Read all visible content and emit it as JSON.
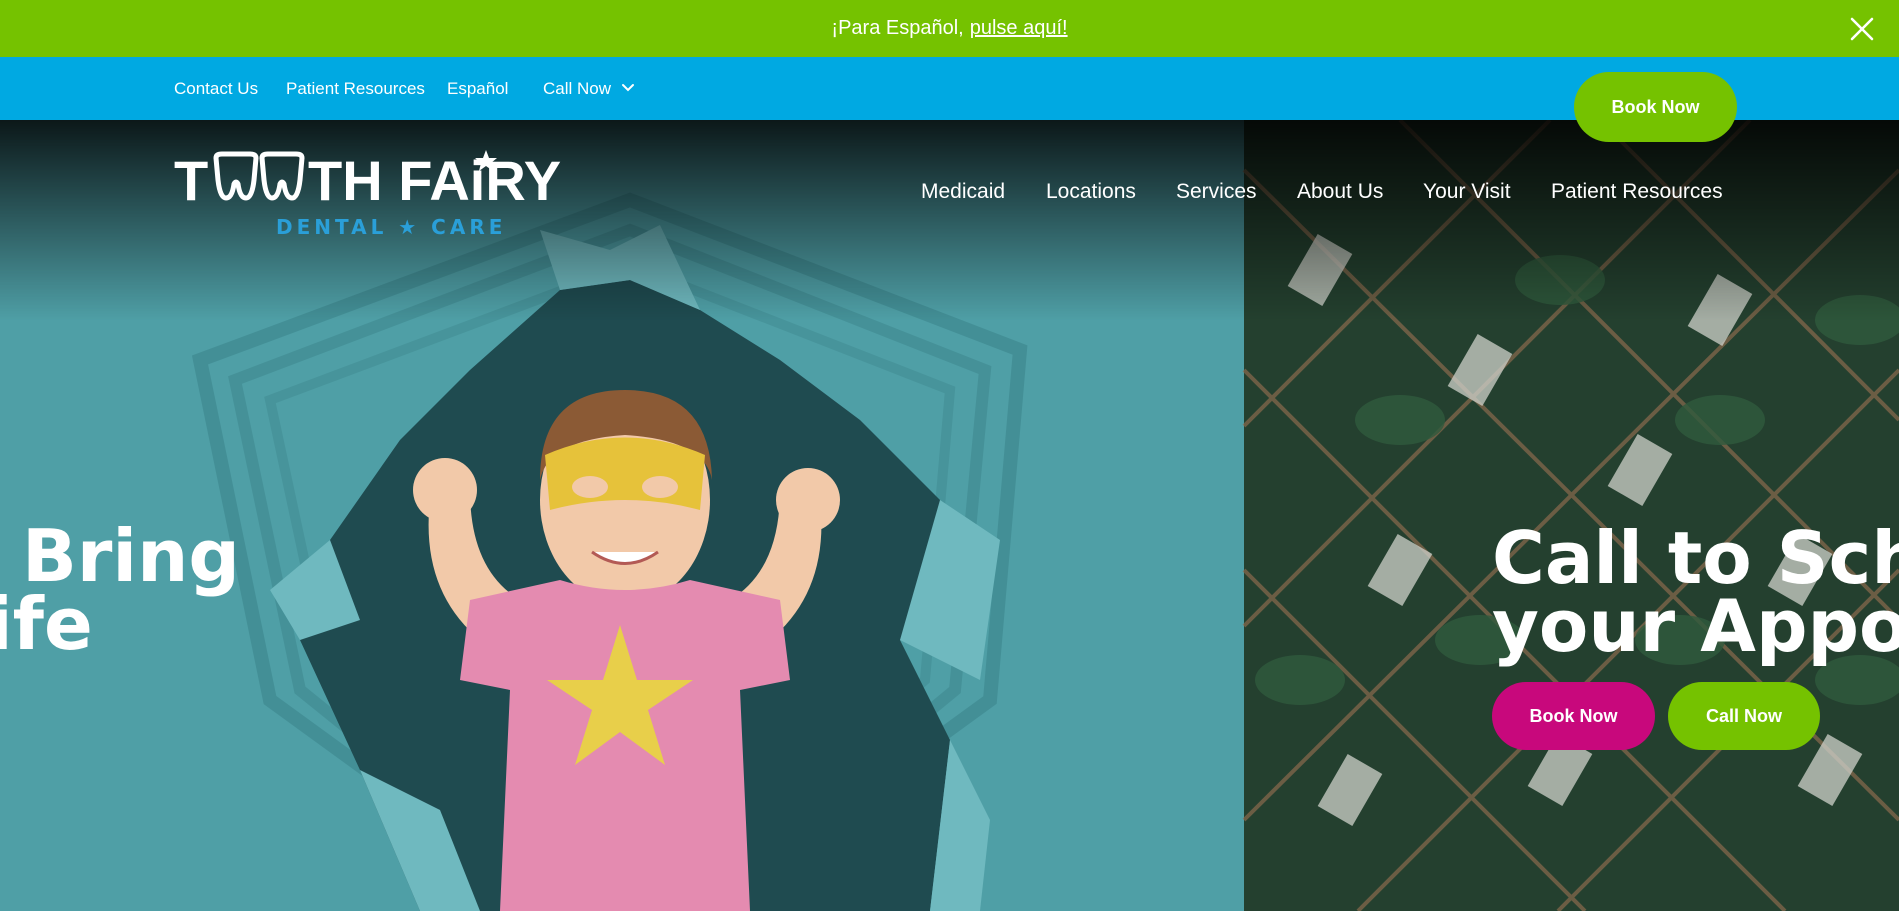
{
  "announcement": {
    "text": "¡Para Español,",
    "link": "pulse aquí!"
  },
  "utility_nav": {
    "items": [
      "Contact Us",
      "Patient Resources",
      "Español",
      "Call Now"
    ],
    "book_label": "Book Now"
  },
  "logo": {
    "wordmark": "TOOTH FAIRY",
    "tagline": "DENTAL ★ CARE"
  },
  "main_nav": [
    "Medicaid",
    "Locations",
    "Services",
    "About Us",
    "Your Visit",
    "Patient Resources"
  ],
  "hero": {
    "left_slide": {
      "line1": "Bring",
      "line2": "ife"
    },
    "right_slide": {
      "line1": "Call to Sche",
      "line2": "your Appoi",
      "book_label": "Book Now",
      "call_label": "Call Now"
    }
  },
  "colors": {
    "green": "#75c200",
    "blue": "#00a9e2",
    "magenta": "#c8087c",
    "teal": "#4c9ba2",
    "logo_blue": "#2a9fd8"
  },
  "icons": {
    "close": "close-icon",
    "chevron": "chevron-down-icon"
  }
}
